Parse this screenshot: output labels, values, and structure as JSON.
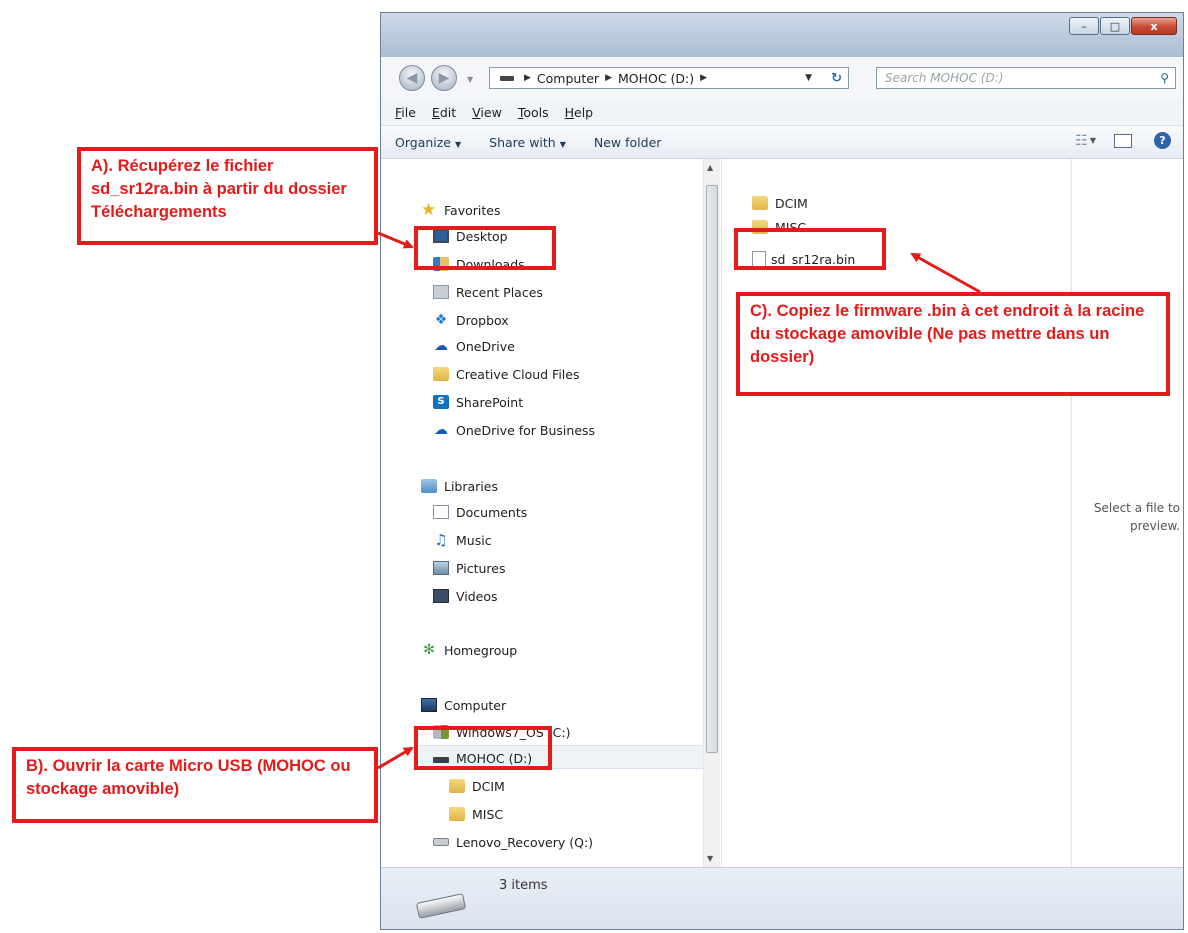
{
  "window": {
    "caption_min": "–",
    "caption_max": "□",
    "caption_close": "x"
  },
  "address": {
    "crumbs": [
      "Computer",
      "MOHOC (D:)"
    ],
    "search_placeholder": "Search MOHOC (D:)"
  },
  "menu": {
    "file": "File",
    "edit": "Edit",
    "view": "View",
    "tools": "Tools",
    "help": "Help"
  },
  "commands": {
    "organize": "Organize",
    "share": "Share with",
    "new_folder": "New folder"
  },
  "nav": {
    "favorites": "Favorites",
    "desktop": "Desktop",
    "downloads": "Downloads",
    "recent": "Recent Places",
    "dropbox": "Dropbox",
    "onedrive": "OneDrive",
    "creative": "Creative Cloud Files",
    "sharepoint": "SharePoint",
    "odb": "OneDrive for Business",
    "libraries": "Libraries",
    "documents": "Documents",
    "music": "Music",
    "pictures": "Pictures",
    "videos": "Videos",
    "homegroup": "Homegroup",
    "computer": "Computer",
    "win7": "Windows7_OS (C:)",
    "mohoc": "MOHOC (D:)",
    "dcim": "DCIM",
    "misc": "MISC",
    "lenovo": "Lenovo_Recovery (Q:)"
  },
  "files": {
    "dcim": "DCIM",
    "misc": "MISC",
    "bin": "sd_sr12ra.bin"
  },
  "preview_text": "Select a file to preview.",
  "status": {
    "items": "3 items"
  },
  "annotations": {
    "a": "A). Récupérez le fichier sd_sr12ra.bin à partir du dossier Téléchargements",
    "b": "B).  Ouvrir la carte Micro USB (MOHOC ou stockage amovible)",
    "c": "C). Copiez le firmware .bin à cet endroit à la racine du stockage amovible (Ne pas mettre dans un dossier)",
    "color": "#e31b1b"
  }
}
